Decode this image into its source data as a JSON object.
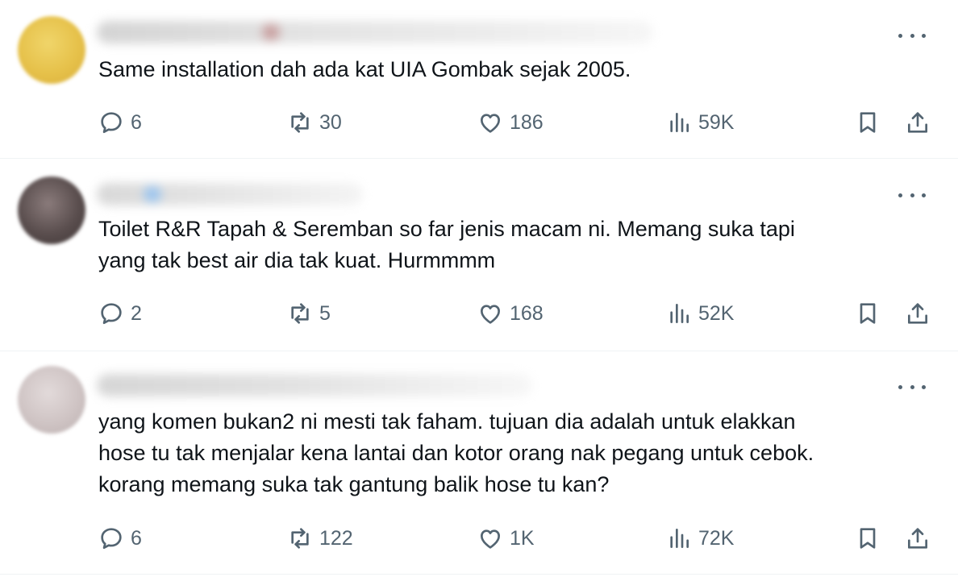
{
  "replies": [
    {
      "text": "Same installation dah ada kat UIA Gombak sejak 2005.",
      "replies_count": "6",
      "reposts": "30",
      "likes": "186",
      "views": "59K",
      "avatar_color": "#e6c14a"
    },
    {
      "text": "Toilet R&R Tapah & Seremban so far jenis macam ni. Memang suka tapi\nyang tak best air dia tak kuat. Hurmmmm",
      "replies_count": "2",
      "reposts": "5",
      "likes": "168",
      "views": "52K",
      "avatar_color": "#5a4e4e"
    },
    {
      "text": "yang komen bukan2 ni mesti tak faham. tujuan dia adalah untuk elakkan\nhose tu tak menjalar kena lantai dan kotor orang nak pegang untuk cebok.\nkorang memang suka tak gantung balik hose tu kan?",
      "replies_count": "6",
      "reposts": "122",
      "likes": "1K",
      "views": "72K",
      "avatar_color": "#cfc4c4"
    }
  ],
  "icons": {
    "reply": "reply-icon",
    "repost": "repost-icon",
    "like": "heart-icon",
    "views": "views-icon",
    "bookmark": "bookmark-icon",
    "share": "share-icon",
    "more": "more-icon"
  }
}
